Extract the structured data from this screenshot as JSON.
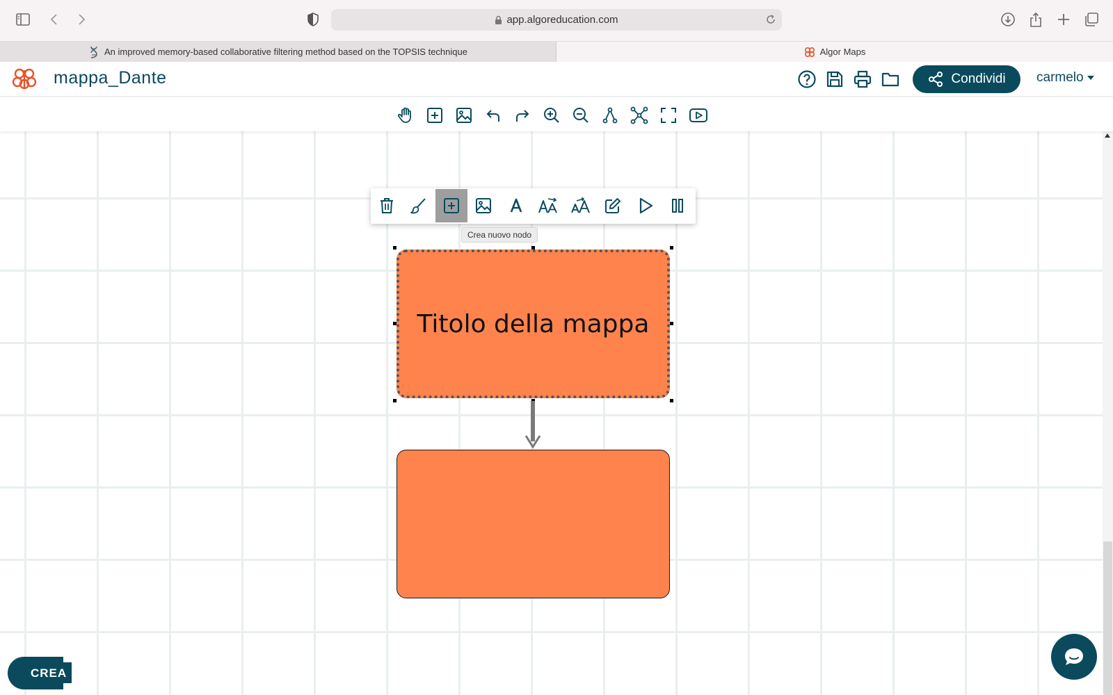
{
  "browser": {
    "url": "app.algoreducation.com",
    "tabs": [
      {
        "label": "An improved memory-based collaborative filtering method based on the TOPSIS technique",
        "active": false
      },
      {
        "label": "Algor Maps",
        "active": true
      }
    ]
  },
  "header": {
    "document_title": "mappa_Dante",
    "share_label": "Condividi",
    "user_name": "carmelo",
    "brand_color": "#0b4a5d",
    "logo_color": "#e8532b"
  },
  "toolbar": {
    "tools": [
      "hand-icon",
      "add-node-icon",
      "image-icon",
      "undo-icon",
      "redo-icon",
      "zoom-in-icon",
      "zoom-out-icon",
      "tree-layout-icon",
      "network-layout-icon",
      "fullscreen-icon",
      "presentation-icon"
    ]
  },
  "node_toolbar": {
    "tools": [
      "trash-icon",
      "brush-icon",
      "add-node-icon",
      "image-icon",
      "font-icon",
      "font-size-decrease-icon",
      "font-size-increase-icon",
      "edit-icon",
      "play-icon",
      "pause-icon"
    ],
    "active_tool": "add-node-icon",
    "tooltip": "Crea nuovo nodo"
  },
  "canvas": {
    "nodes": [
      {
        "id": "title",
        "text": "Titolo della mappa",
        "color": "#ff834d",
        "selected": true
      },
      {
        "id": "child",
        "text": "",
        "color": "#ff834d",
        "selected": false
      }
    ]
  },
  "bottom": {
    "create_label": "CREA"
  }
}
